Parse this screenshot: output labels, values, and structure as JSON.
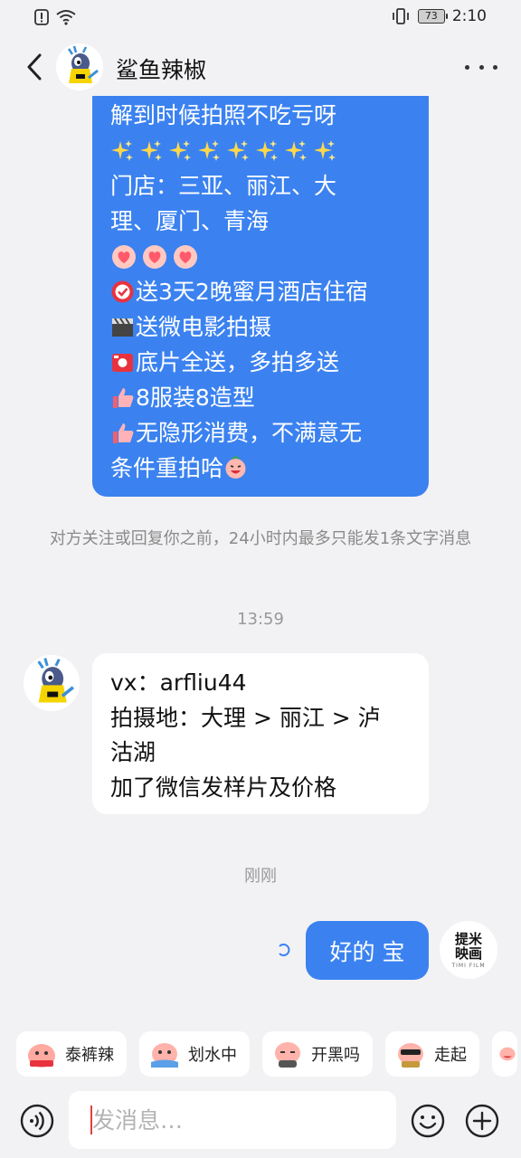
{
  "status_bar": {
    "battery": "73",
    "time": "2:10"
  },
  "header": {
    "title": "鲨鱼辣椒",
    "back_icon": "chevron-left-icon",
    "more_icon": "more-dots-icon"
  },
  "messages": {
    "promo": {
      "line1": "解到时候拍照不吃亏呀",
      "line2": "门店：三亚、丽江、大",
      "line3": "理、厦门、青海",
      "item1": "送3天2晚蜜月酒店住宿",
      "item2": "送微电影拍摄",
      "item3": "底片全送，多拍多送",
      "item4": "8服装8造型",
      "item5": "无隐形消费，不满意无",
      "item6": "条件重拍哈"
    },
    "notice": "对方关注或回复你之前，24小时内最多只能发1条文字消息",
    "time1": "13:59",
    "reply": {
      "line1": "vx：arfliu44",
      "line2": "拍摄地：大理 > 丽江 > 泸",
      "line3": "沽湖",
      "line4": "加了微信发样片及价格"
    },
    "time2": "刚刚",
    "mine": "好的 宝",
    "mine_avatar_line1": "提米",
    "mine_avatar_line2": "映画",
    "mine_avatar_sub": "TIMI FILM"
  },
  "quick_replies": [
    {
      "label": "泰裤辣",
      "icon": "meme-face-icon"
    },
    {
      "label": "划水中",
      "icon": "meme-face-icon"
    },
    {
      "label": "开黑吗",
      "icon": "meme-face-icon"
    },
    {
      "label": "走起",
      "icon": "meme-face-icon"
    }
  ],
  "input": {
    "placeholder": "发消息…"
  },
  "colors": {
    "accent_blue": "#3b82f0",
    "background": "#f2f2f4"
  }
}
